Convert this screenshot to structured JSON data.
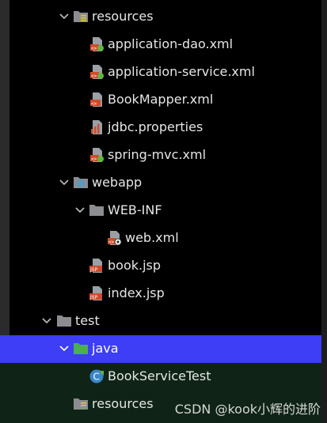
{
  "colors": {
    "background": "#000000",
    "selection": "#3d3ef5",
    "lower_background": "#0f2416",
    "text": "#e6e6e6",
    "folder": "#8b8d90",
    "java_folder": "#4caf50",
    "xml_accent": "#d24b29",
    "spring_leaf": "#62b543"
  },
  "tree": {
    "items": [
      {
        "label": "resources",
        "icon": "resources-folder-icon",
        "expanded": true
      },
      {
        "label": "application-dao.xml",
        "icon": "spring-xml-file-icon"
      },
      {
        "label": "application-service.xml",
        "icon": "spring-xml-file-icon"
      },
      {
        "label": "BookMapper.xml",
        "icon": "mybatis-xml-file-icon"
      },
      {
        "label": "jdbc.properties",
        "icon": "properties-file-icon"
      },
      {
        "label": "spring-mvc.xml",
        "icon": "spring-xml-file-icon"
      },
      {
        "label": "webapp",
        "icon": "web-folder-icon",
        "expanded": true
      },
      {
        "label": "WEB-INF",
        "icon": "folder-icon",
        "expanded": true
      },
      {
        "label": "web.xml",
        "icon": "web-xml-file-icon"
      },
      {
        "label": "book.jsp",
        "icon": "jsp-file-icon"
      },
      {
        "label": "index.jsp",
        "icon": "jsp-file-icon"
      },
      {
        "label": "test",
        "icon": "folder-icon",
        "expanded": true
      },
      {
        "label": "java",
        "icon": "java-test-folder-icon",
        "expanded": true,
        "selected": true
      },
      {
        "label": "BookServiceTest",
        "icon": "test-class-icon"
      },
      {
        "label": "resources",
        "icon": "test-resources-folder-icon"
      }
    ]
  },
  "watermark": "CSDN @kook小辉的进阶"
}
